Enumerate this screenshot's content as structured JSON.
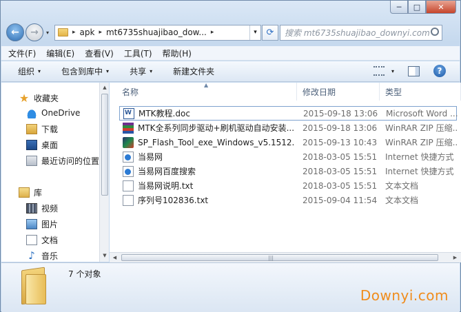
{
  "window": {
    "caption": {
      "minimize": "─",
      "maximize": "□",
      "close": "✕"
    }
  },
  "nav": {
    "back_glyph": "←",
    "forward_glyph": "→",
    "dropdown_glyph": "▾",
    "breadcrumb": [
      "apk",
      "mt6735shuajibao_dow..."
    ],
    "breadcrumb_sep": "▸",
    "address_dropdown": "▾",
    "refresh_glyph": "⟳",
    "search_placeholder": "搜索 mt6735shuajibao_downyi.com"
  },
  "menubar": [
    "文件(F)",
    "编辑(E)",
    "查看(V)",
    "工具(T)",
    "帮助(H)"
  ],
  "toolbar": {
    "items": [
      {
        "label": "组织",
        "caret": "▾"
      },
      {
        "label": "包含到库中",
        "caret": "▾"
      },
      {
        "label": "共享",
        "caret": "▾"
      },
      {
        "label": "新建文件夹",
        "caret": ""
      }
    ],
    "views_caret": "▾",
    "help_glyph": "?"
  },
  "sidebar": {
    "items": [
      {
        "label": "收藏夹",
        "icon": "star-icon"
      },
      {
        "label": "OneDrive",
        "icon": "cloud-icon"
      },
      {
        "label": "下载",
        "icon": "downloads-icon"
      },
      {
        "label": "桌面",
        "icon": "desktop-icon"
      },
      {
        "label": "最近访问的位置",
        "icon": "recent-places-icon"
      },
      {
        "label": "库",
        "icon": "libraries-icon"
      },
      {
        "label": "视频",
        "icon": "videos-icon"
      },
      {
        "label": "图片",
        "icon": "pictures-icon"
      },
      {
        "label": "文档",
        "icon": "documents-icon"
      },
      {
        "label": "音乐",
        "icon": "music-icon"
      }
    ],
    "star_glyph": "★",
    "music_glyph": "♪"
  },
  "columns": {
    "name": "名称",
    "date": "修改日期",
    "type": "类型",
    "sort_glyph": "▲"
  },
  "files": [
    {
      "name": "MTK教程.doc",
      "date": "2015-09-18 13:06",
      "type": "Microsoft Word ...",
      "icon": "word-document-icon",
      "selected": true
    },
    {
      "name": "MTK全系列同步驱动+刷机驱动自动安装...",
      "date": "2015-09-18 13:06",
      "type": "WinRAR ZIP 压缩...",
      "icon": "winrar-zip-icon",
      "selected": false
    },
    {
      "name": "SP_Flash_Tool_exe_Windows_v5.1512....",
      "date": "2015-09-13 10:43",
      "type": "WinRAR ZIP 压缩...",
      "icon": "flash-tool-archive-icon",
      "selected": false
    },
    {
      "name": "当易网",
      "date": "2018-03-05 15:51",
      "type": "Internet 快捷方式",
      "icon": "internet-shortcut-icon",
      "selected": false
    },
    {
      "name": "当易网百度搜索",
      "date": "2018-03-05 15:51",
      "type": "Internet 快捷方式",
      "icon": "internet-shortcut-icon",
      "selected": false
    },
    {
      "name": "当易网说明.txt",
      "date": "2018-03-05 15:51",
      "type": "文本文档",
      "icon": "text-file-icon",
      "selected": false
    },
    {
      "name": "序列号102836.txt",
      "date": "2015-09-04 11:54",
      "type": "文本文档",
      "icon": "text-file-icon",
      "selected": false
    }
  ],
  "scroll": {
    "up": "▲",
    "down": "▼",
    "left": "◀",
    "right": "▶",
    "grip": "|||"
  },
  "details": {
    "item_count": "7 个对象"
  },
  "watermark": "Downyi.com"
}
